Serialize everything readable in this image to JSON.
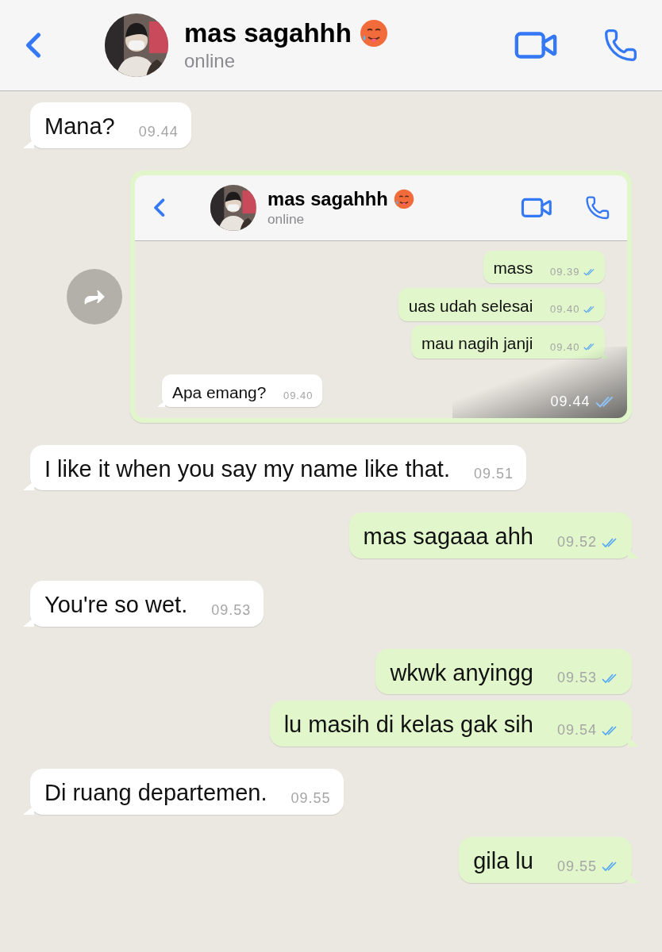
{
  "header": {
    "name": "mas sagahhh",
    "status": "online"
  },
  "messages": [
    {
      "kind": "text",
      "outgoing": false,
      "text": "Mana?",
      "time": "09.44"
    },
    {
      "outgoing": true,
      "time": "09.44",
      "read": true,
      "screenshot": {
        "header": {
          "name": "mas sagahhh",
          "status": "online"
        },
        "messages": [
          {
            "outgoing": true,
            "text": "mass",
            "time": "09.39",
            "read": true
          },
          {
            "outgoing": true,
            "text": "uas udah selesai",
            "time": "09.40",
            "read": true
          },
          {
            "outgoing": true,
            "text": "mau nagih janji",
            "time": "09.40",
            "read": true
          },
          {
            "outgoing": false,
            "text": "Apa emang?",
            "time": "09.40"
          }
        ]
      }
    },
    {
      "kind": "text",
      "outgoing": false,
      "text": "I like it when you say my name like that.",
      "time": "09.51"
    },
    {
      "kind": "text",
      "outgoing": true,
      "text": "mas sagaaa ahh",
      "time": "09.52",
      "read": true
    },
    {
      "kind": "text",
      "outgoing": false,
      "text": "You're so wet.",
      "time": "09.53"
    },
    {
      "kind": "text",
      "outgoing": true,
      "text": "wkwk anyingg",
      "time": "09.53",
      "read": true
    },
    {
      "kind": "text",
      "outgoing": true,
      "text": "lu masih di kelas gak sih",
      "time": "09.54",
      "read": true
    },
    {
      "kind": "text",
      "outgoing": false,
      "text": "Di ruang departemen.",
      "time": "09.55"
    },
    {
      "kind": "text",
      "outgoing": true,
      "text": "gila lu",
      "time": "09.55",
      "read": true
    }
  ]
}
